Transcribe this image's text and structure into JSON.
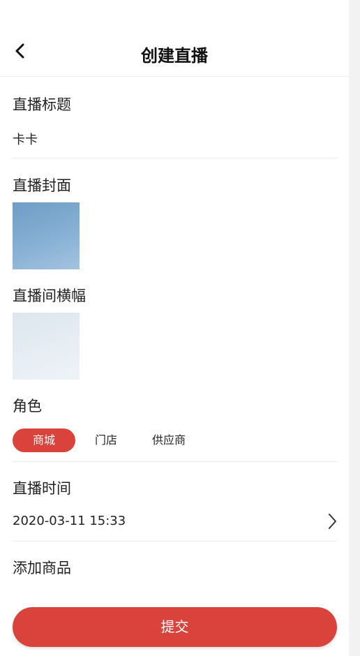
{
  "header": {
    "title": "创建直播",
    "back_icon": "chevron-left-icon"
  },
  "form": {
    "title_label": "直播标题",
    "title_value": "卡卡",
    "cover_label": "直播封面",
    "banner_label": "直播间横幅",
    "role_label": "角色",
    "roles": [
      "商城",
      "门店",
      "供应商"
    ],
    "selected_role": "商城",
    "time_label": "直播时间",
    "time_value": "2020-03-11 15:33",
    "products_label": "添加商品"
  },
  "actions": {
    "submit_label": "提交"
  },
  "colors": {
    "accent": "#d9433b",
    "background": "#ffffff",
    "divider": "#ececec"
  }
}
